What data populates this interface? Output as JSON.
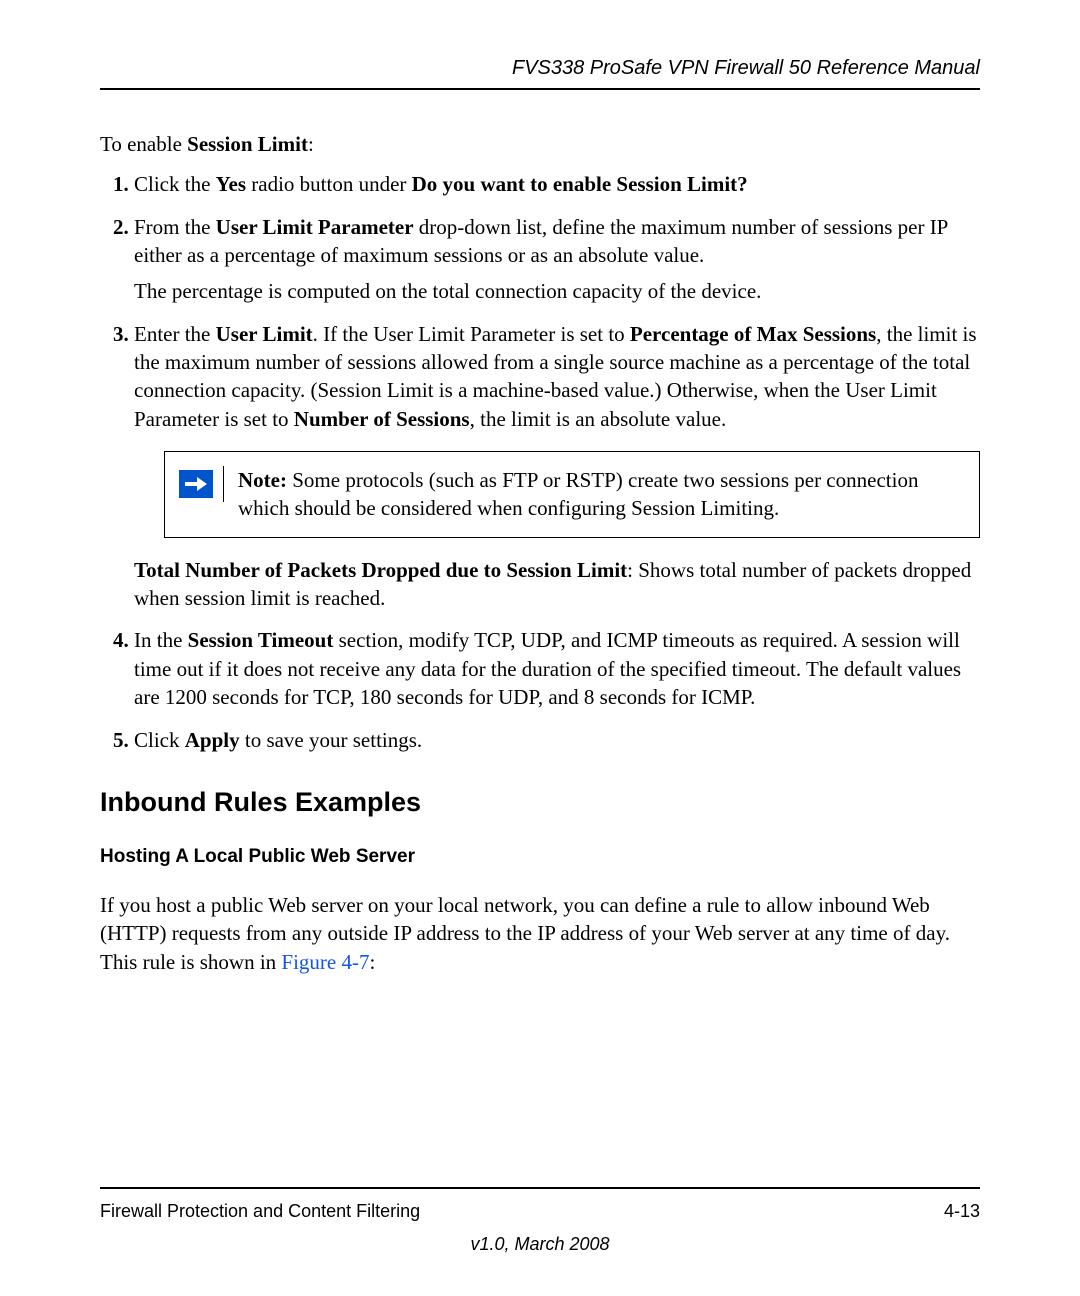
{
  "header": {
    "title": "FVS338 ProSafe VPN Firewall 50 Reference Manual"
  },
  "intro": {
    "prefix": "To enable ",
    "bold": "Session Limit",
    "suffix": ":"
  },
  "steps": {
    "s1": {
      "t1": "Click the ",
      "b1": "Yes",
      "t2": " radio button under ",
      "b2": "Do you want to enable Session Limit?"
    },
    "s2": {
      "t1": "From the ",
      "b1": "User Limit Parameter",
      "t2": " drop-down list, define the maximum number of sessions per IP either as a percentage of maximum sessions or as an absolute value.",
      "p2": "The percentage is computed on the total connection capacity of the device."
    },
    "s3": {
      "t1": "Enter the ",
      "b1": "User Limit",
      "t2": ". If the User Limit Parameter is set to ",
      "b2": "Percentage of Max Sessions",
      "t3": ", the limit is the maximum number of sessions allowed from a single source machine as a percentage of the total connection capacity. (Session Limit is a machine-based value.) Otherwise, when the User Limit Parameter is set to ",
      "b3": "Number of Sessions",
      "t4": ", the limit is an absolute value."
    },
    "note": {
      "label": "Note:",
      "text": " Some protocols (such as FTP or RSTP) create two sessions per connection which should be considered when configuring Session Limiting."
    },
    "packets": {
      "b1": "Total Number of Packets Dropped due to Session Limit",
      "t1": ": Shows total number of packets dropped when session limit is reached."
    },
    "s4": {
      "t1": "In the ",
      "b1": "Session Timeout",
      "t2": " section, modify TCP, UDP, and ICMP timeouts as required. A session will time out if it does not receive any data for the duration of the specified timeout. The default values are 1200 seconds for TCP, 180 seconds for UDP, and 8 seconds for ICMP."
    },
    "s5": {
      "t1": "Click ",
      "b1": "Apply",
      "t2": " to save your settings."
    }
  },
  "section": {
    "title": "Inbound Rules Examples",
    "sub_title": "Hosting A Local Public Web Server",
    "body_t1": "If you host a public Web server on your local network, you can define a rule to allow inbound Web (HTTP) requests from any outside IP address to the IP address of your Web server at any time of day. This rule is shown in ",
    "figlink": "Figure 4-7",
    "body_t2": ":"
  },
  "footer": {
    "left": "Firewall Protection and Content Filtering",
    "right": "4-13",
    "center": "v1.0, March 2008"
  }
}
